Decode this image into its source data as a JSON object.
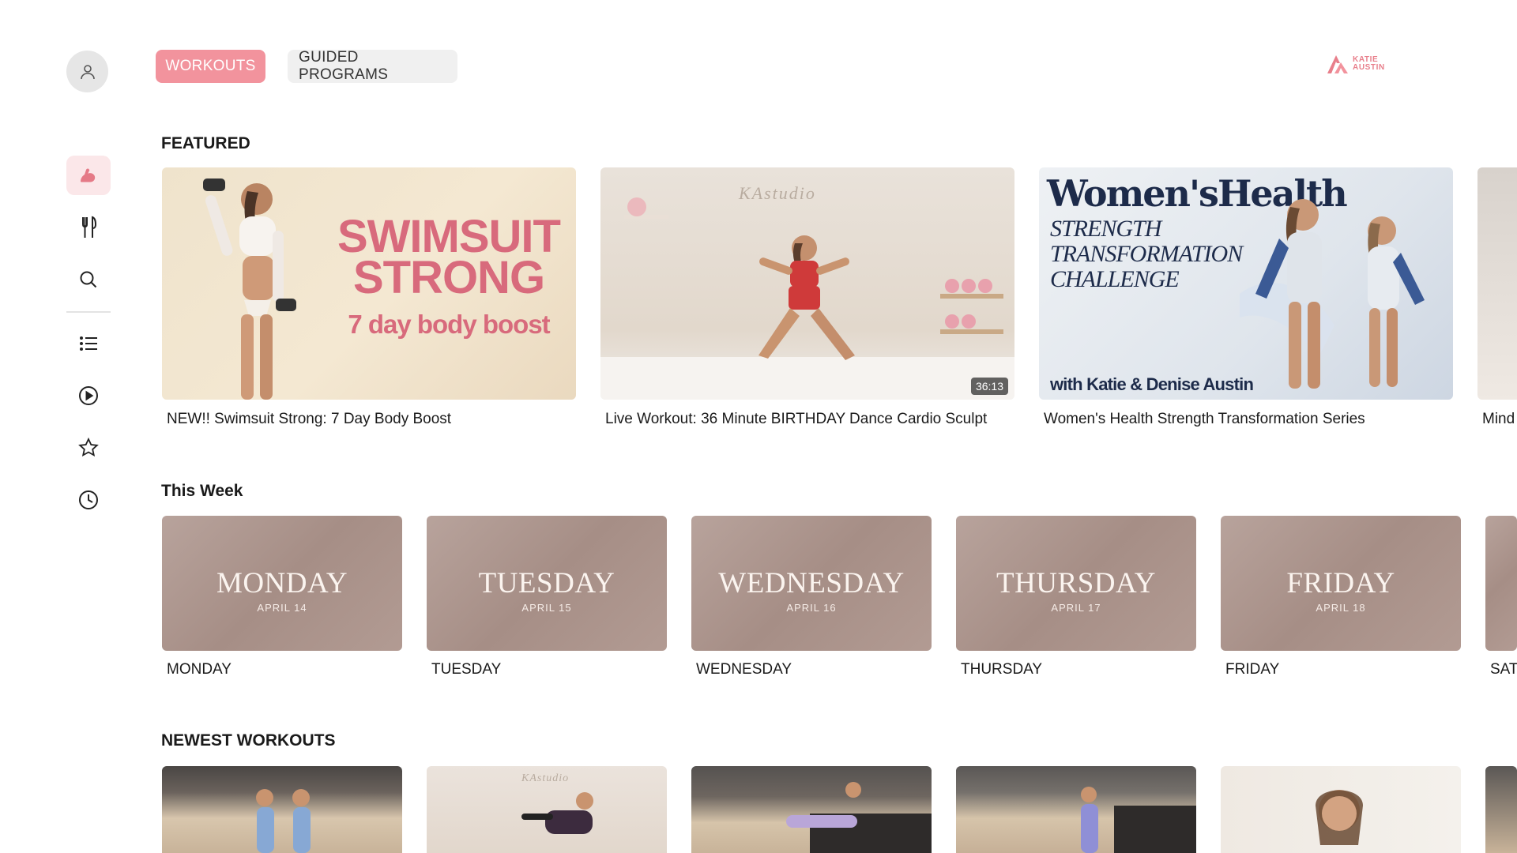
{
  "tabs": {
    "workouts": "WORKOUTS",
    "guided": "GUIDED PROGRAMS"
  },
  "brand": {
    "line1": "KATIE",
    "line2": "AUSTIN"
  },
  "sidebar": {
    "items": [
      "profile-icon",
      "workouts-icon",
      "nutrition-icon",
      "search-icon",
      "list-icon",
      "play-icon",
      "favorites-icon",
      "history-icon"
    ]
  },
  "featured": {
    "title": "FEATURED",
    "cards": [
      {
        "caption": "NEW!! Swimsuit Strong: 7 Day Body Boost",
        "art_title_1": "SWIMSUIT",
        "art_title_2": "STRONG",
        "art_sub": "7 day body boost"
      },
      {
        "caption": "Live Workout: 36 Minute BIRTHDAY Dance Cardio Sculpt",
        "studio": "KAstudio",
        "duration": "36:13"
      },
      {
        "caption": "Women's Health Strength Transformation Series",
        "logo": "Women'sHealth",
        "sub1": "STRENGTH",
        "sub2": "TRANSFORMATION",
        "sub3": "CHALLENGE",
        "with": "with Katie & Denise Austin"
      },
      {
        "caption": "Mind"
      }
    ]
  },
  "this_week": {
    "title": "This Week",
    "days": [
      {
        "name": "MONDAY",
        "date": "APRIL 14",
        "caption": "MONDAY"
      },
      {
        "name": "TUESDAY",
        "date": "APRIL 15",
        "caption": "TUESDAY"
      },
      {
        "name": "WEDNESDAY",
        "date": "APRIL 16",
        "caption": "WEDNESDAY"
      },
      {
        "name": "THURSDAY",
        "date": "APRIL 17",
        "caption": "THURSDAY"
      },
      {
        "name": "FRIDAY",
        "date": "APRIL 18",
        "caption": "FRIDAY"
      },
      {
        "caption": "SAT"
      }
    ]
  },
  "newest": {
    "title": "NEWEST WORKOUTS",
    "studio": "KAstudio"
  },
  "colors": {
    "accent": "#f2939d",
    "brand": "#e87f8b"
  }
}
